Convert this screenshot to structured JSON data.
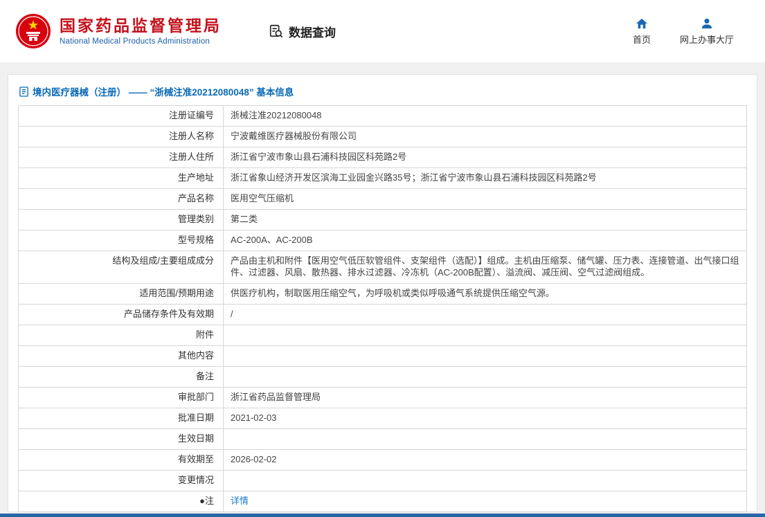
{
  "header": {
    "org_zh": "国家药品监督管理局",
    "org_en": "National Medical Products Administration",
    "data_query": "数据查询",
    "nav_home": "首页",
    "nav_hall": "网上办事大厅"
  },
  "content": {
    "title": "境内医疗器械（注册） ——  “浙械注准20212080048”  基本信息",
    "rows": [
      {
        "label": "注册证编号",
        "value": "浙械注准20212080048"
      },
      {
        "label": "注册人名称",
        "value": "宁波戴维医疗器械股份有限公司"
      },
      {
        "label": "注册人住所",
        "value": "浙江省宁波市象山县石浦科技园区科苑路2号"
      },
      {
        "label": "生产地址",
        "value": "浙江省象山经济开发区滨海工业园金兴路35号；浙江省宁波市象山县石浦科技园区科苑路2号"
      },
      {
        "label": "产品名称",
        "value": "医用空气压缩机"
      },
      {
        "label": "管理类别",
        "value": "第二类"
      },
      {
        "label": "型号规格",
        "value": "AC-200A、AC-200B"
      },
      {
        "label": "结构及组成/主要组成成分",
        "value": "产品由主机和附件【医用空气低压软管组件、支架组件（选配）】组成。主机由压缩泵、储气罐、压力表、连接管道、出气接口组件、过滤器、风扇、散热器、排水过滤器、冷冻机（AC-200B配置）、溢流阀、减压阀、空气过滤阀组成。"
      },
      {
        "label": "适用范围/预期用途",
        "value": "供医疗机构，制取医用压缩空气，为呼吸机或类似呼吸通气系统提供压缩空气源。"
      },
      {
        "label": "产品储存条件及有效期",
        "value": "/"
      },
      {
        "label": "附件",
        "value": ""
      },
      {
        "label": "其他内容",
        "value": ""
      },
      {
        "label": "备注",
        "value": ""
      },
      {
        "label": "审批部门",
        "value": "浙江省药品监督管理局"
      },
      {
        "label": "批准日期",
        "value": "2021-02-03"
      },
      {
        "label": "生效日期",
        "value": ""
      },
      {
        "label": "有效期至",
        "value": "2026-02-02"
      },
      {
        "label": "变更情况",
        "value": ""
      },
      {
        "label": "●注",
        "value": "详情",
        "link": true
      }
    ]
  },
  "colors": {
    "brand_red": "#c3121c",
    "brand_blue": "#1a5fab",
    "title_blue": "#0a6ab6",
    "link_blue": "#1a7bd1",
    "footer_blue": "#2566a8"
  }
}
